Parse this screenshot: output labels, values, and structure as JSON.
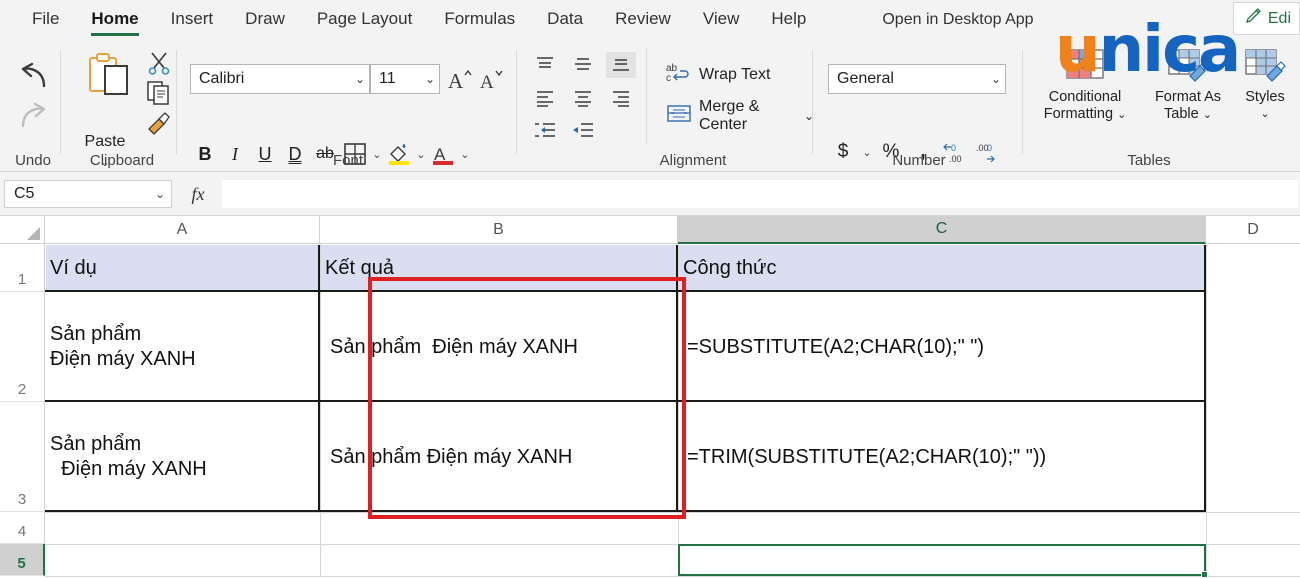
{
  "tabs": [
    {
      "label": "File",
      "active": false
    },
    {
      "label": "Home",
      "active": true
    },
    {
      "label": "Insert",
      "active": false
    },
    {
      "label": "Draw",
      "active": false
    },
    {
      "label": "Page Layout",
      "active": false
    },
    {
      "label": "Formulas",
      "active": false
    },
    {
      "label": "Data",
      "active": false
    },
    {
      "label": "Review",
      "active": false
    },
    {
      "label": "View",
      "active": false
    },
    {
      "label": "Help",
      "active": false
    }
  ],
  "titlebar": {
    "open_in_desktop": "Open in Desktop App",
    "edit_label": "Edi",
    "edit_icon": "pencil-icon"
  },
  "watermark": {
    "part1": "u",
    "part2": "nica",
    "color1": "#f0821e",
    "color2": "#1565c0"
  },
  "ribbon": {
    "groups": {
      "undo": {
        "label": "Undo",
        "undo_icon": "undo-arrow-icon",
        "redo_icon": "redo-arrow-icon"
      },
      "clipboard": {
        "label": "Clipboard",
        "paste_label": "Paste",
        "paste_icon": "clipboard-paste-icon",
        "cut_icon": "scissors-icon",
        "copy_icon": "copy-pages-icon",
        "format_painter_icon": "format-painter-brush-icon",
        "chevron": "⌄"
      },
      "font": {
        "label": "Font",
        "font_name": "Calibri",
        "font_size": "11",
        "grow_font_icon": "grow-font-icon",
        "shrink_font_icon": "shrink-font-icon",
        "bold": "B",
        "italic": "I",
        "underline": "U",
        "double_underline": "D",
        "strikethrough": "ab",
        "borders_icon": "borders-grid-icon",
        "fill_color_icon": "fill-color-icon",
        "font_color_icon": "font-color-icon",
        "fill_color": "#ffe600",
        "font_color": "#d92b2b",
        "chevron": "⌄"
      },
      "alignment": {
        "label": "Alignment",
        "top_align_icon": "align-top-icon",
        "middle_align_icon": "align-middle-icon",
        "bottom_align_icon": "align-bottom-icon",
        "align_left_icon": "align-left-icon",
        "align_center_icon": "align-center-icon",
        "align_right_icon": "align-right-icon",
        "decrease_indent_icon": "decrease-indent-icon",
        "increase_indent_icon": "increase-indent-icon",
        "wrap_text_label": "Wrap Text",
        "wrap_text_icon": "wrap-text-icon",
        "merge_center_label": "Merge & Center",
        "merge_center_icon": "merge-center-icon",
        "chevron": "⌄"
      },
      "number": {
        "label": "Number",
        "format": "General",
        "currency_icon": "dollar-icon",
        "percent_icon": "percent-icon",
        "comma_icon": "comma-style-icon",
        "increase_decimal_icon": "increase-decimal-icon",
        "decrease_decimal_icon": "decrease-decimal-icon",
        "chevron": "⌄"
      },
      "tables": {
        "label": "Tables",
        "conditional_formatting": "Conditional\nFormatting",
        "conditional_formatting_l1": "Conditional",
        "conditional_formatting_l2": "Formatting",
        "conditional_formatting_icon": "conditional-formatting-icon",
        "format_as_table_l1": "Format As",
        "format_as_table_l2": "Table",
        "format_as_table_icon": "format-as-table-icon",
        "styles_label": "Styles",
        "styles_icon": "cell-styles-icon",
        "chevron": "⌄"
      }
    }
  },
  "formula_bar": {
    "name_box_value": "C5",
    "fx_label": "fx",
    "formula_value": "",
    "chevron": "⌄"
  },
  "sheet": {
    "columns": [
      {
        "label": "A",
        "selected": false
      },
      {
        "label": "B",
        "selected": false
      },
      {
        "label": "C",
        "selected": true
      },
      {
        "label": "D",
        "selected": false
      }
    ],
    "rows": [
      {
        "label": "1",
        "selected": false
      },
      {
        "label": "2",
        "selected": false
      },
      {
        "label": "3",
        "selected": false
      },
      {
        "label": "4",
        "selected": false
      },
      {
        "label": "5",
        "selected": true
      }
    ],
    "cells": {
      "A1": "Ví dụ",
      "B1": "Kết quả",
      "C1": "Công thức",
      "A2": "Sản phẩm\nĐiện máy XANH",
      "B2": "Sản phẩm  Điện máy XANH",
      "C2": "=SUBSTITUTE(A2;CHAR(10);\" \")",
      "A3": "Sản phẩm\n  Điện máy XANH",
      "B3": "Sản phẩm Điện máy XANH",
      "C3": "=TRIM(SUBSTITUTE(A2;CHAR(10);\" \"))",
      "A4": "",
      "B4": "",
      "C4": "",
      "A5": "",
      "B5": "",
      "C5": ""
    },
    "active_cell": "C5",
    "header_fill": "#d9dff0",
    "annotation_box_color": "#e02020",
    "selection_color": "#217346"
  }
}
